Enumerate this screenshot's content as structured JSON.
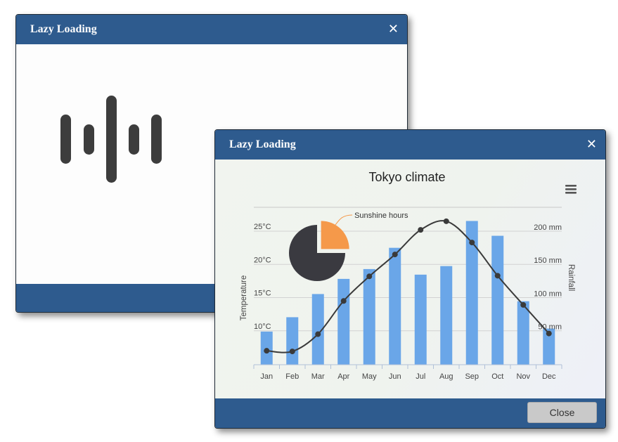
{
  "loader_window": {
    "title": "Lazy Loading",
    "close_glyph": "✕"
  },
  "chart_window": {
    "title": "Lazy Loading",
    "close_glyph": "✕",
    "close_button": "Close",
    "menu_icon": "hamburger-menu-icon"
  },
  "colors": {
    "titlebar": "#2e5b8e",
    "bars": "#6aa6e8",
    "line": "#3a3a3a",
    "pie_dark": "#3a3a40",
    "pie_orange": "#f5994a"
  },
  "chart_data": {
    "type": "bar",
    "title": "Tokyo climate",
    "categories": [
      "Jan",
      "Feb",
      "Mar",
      "Apr",
      "May",
      "Jun",
      "Jul",
      "Aug",
      "Sep",
      "Oct",
      "Nov",
      "Dec"
    ],
    "series": [
      {
        "name": "Rainfall",
        "type": "bar",
        "axis": "right",
        "values": [
          49.9,
          71.5,
          106.4,
          129.2,
          144.0,
          176.0,
          135.6,
          148.5,
          216.4,
          194.1,
          95.6,
          54.4
        ]
      },
      {
        "name": "Temperature",
        "type": "line",
        "axis": "left",
        "values": [
          7.0,
          6.9,
          9.5,
          14.5,
          18.2,
          21.5,
          25.2,
          26.5,
          23.3,
          18.3,
          13.9,
          9.6
        ]
      }
    ],
    "y_left": {
      "label": "Temperature",
      "ticks": [
        "10°C",
        "15°C",
        "20°C",
        "25°C"
      ],
      "tick_values": [
        10,
        15,
        20,
        25
      ],
      "range": [
        4.9,
        28.6
      ]
    },
    "y_right": {
      "label": "Rainfall",
      "ticks": [
        "50 mm",
        "100 mm",
        "150 mm",
        "200 mm"
      ],
      "tick_values": [
        50,
        100,
        150,
        200
      ],
      "range": [
        0,
        237
      ]
    },
    "pie": {
      "label": "Sunshine hours",
      "slices": [
        {
          "value": 75,
          "color": "#3a3a40"
        },
        {
          "value": 25,
          "color": "#f5994a",
          "sliced": true
        }
      ]
    },
    "grid": true,
    "legend": "none"
  }
}
